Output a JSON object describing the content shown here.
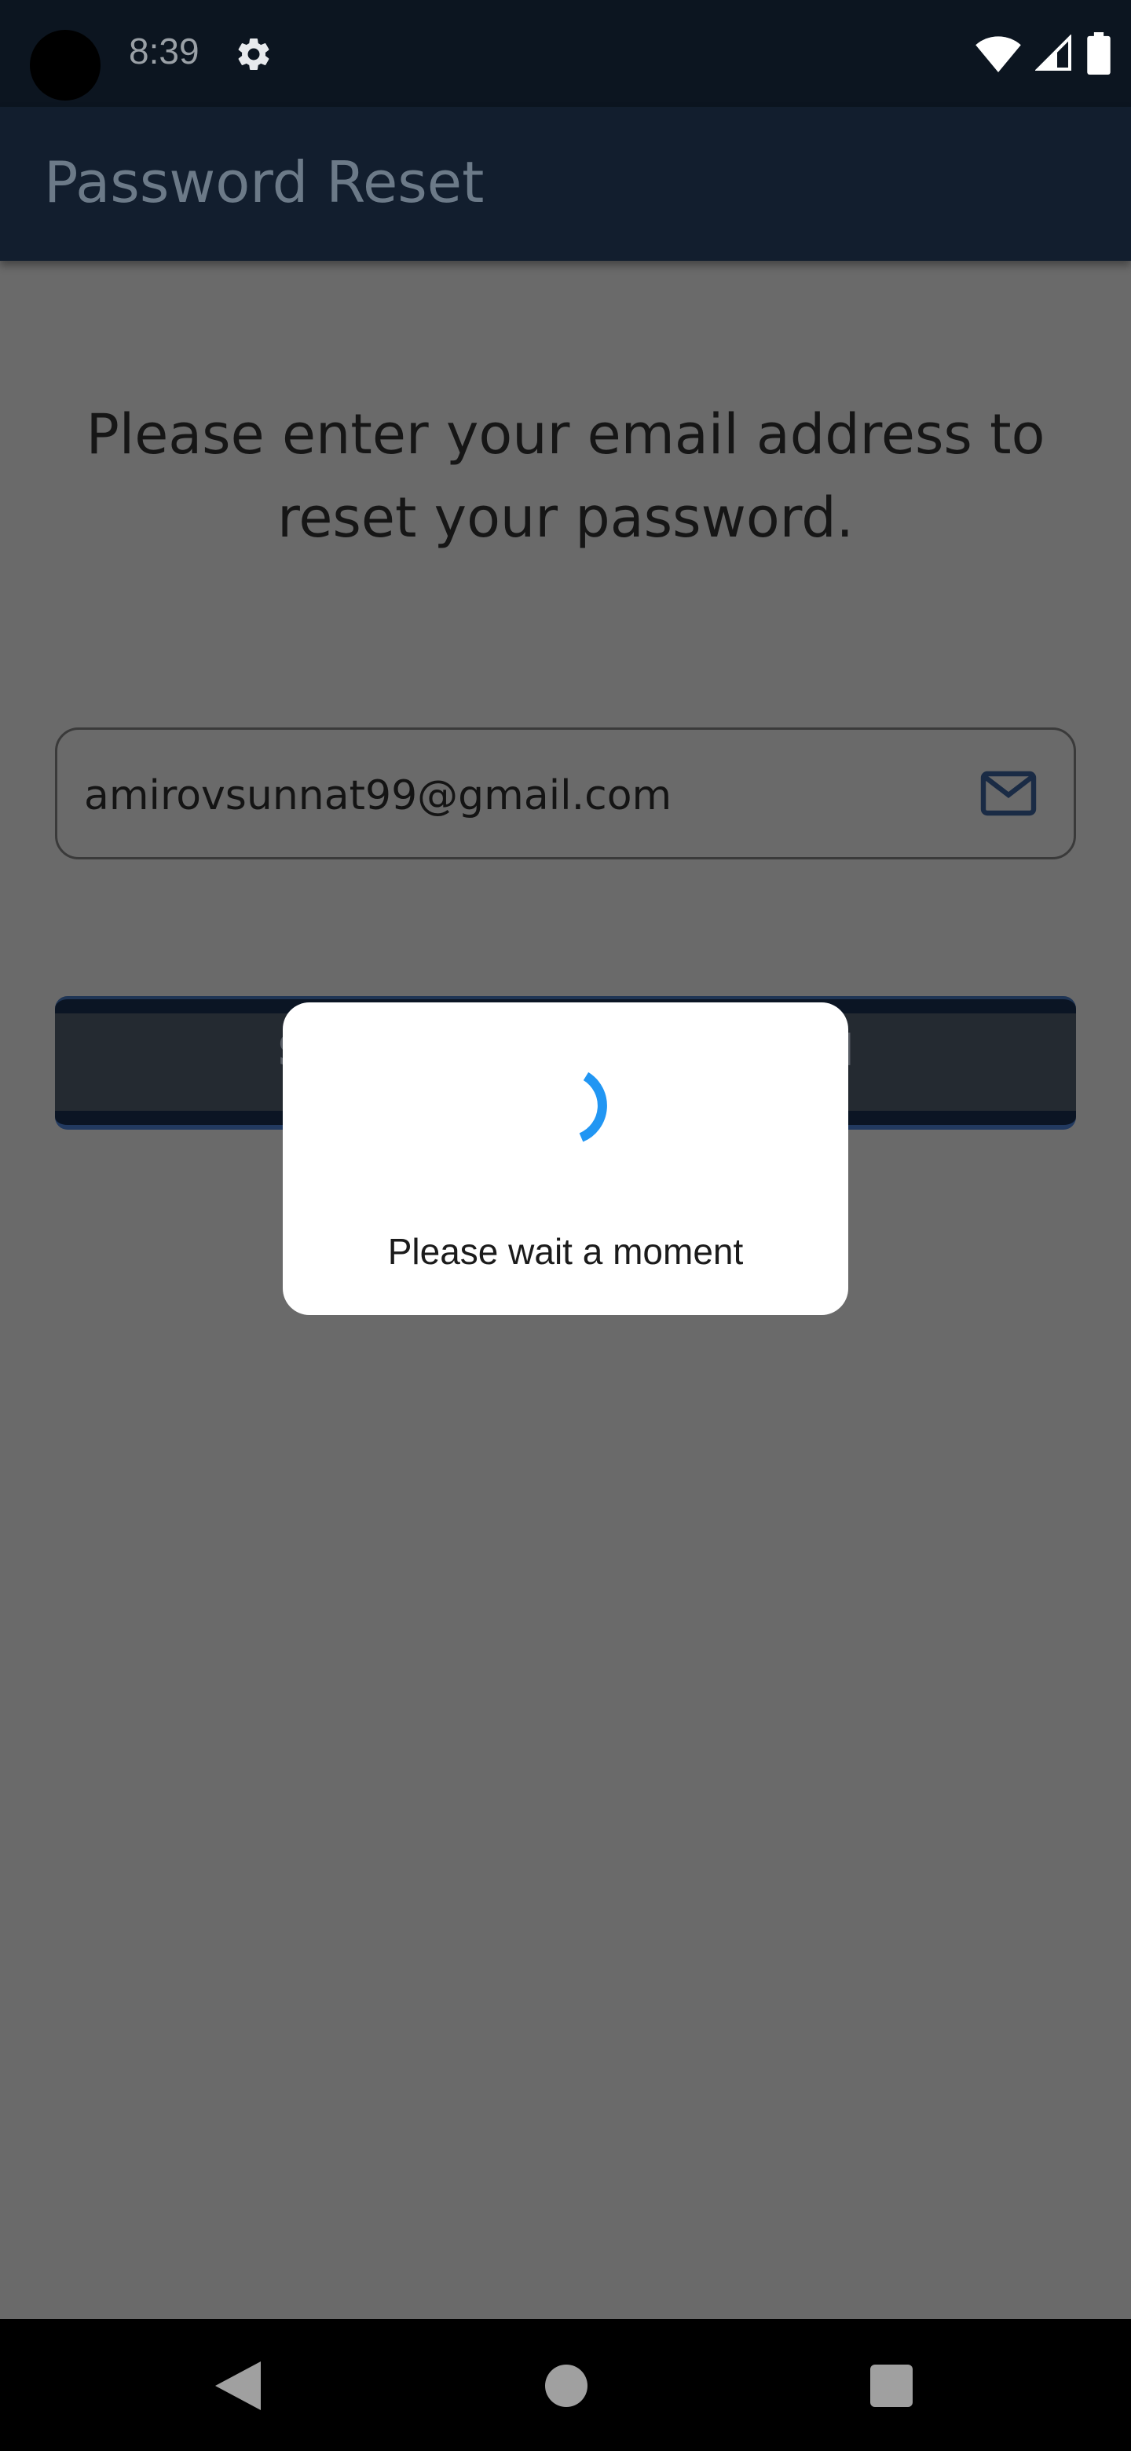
{
  "status_bar": {
    "time": "8:39",
    "icons": [
      "gear-icon",
      "wifi-icon",
      "cellular-signal-icon",
      "battery-icon"
    ]
  },
  "app_bar": {
    "title": "Password Reset"
  },
  "main": {
    "instructions_line1": "Please enter your email address to",
    "instructions_line2": "reset your password.",
    "email_field": {
      "value": "amirovsunnat99@gmail.com",
      "icon": "mail-icon"
    },
    "submit_button": {
      "visible_label": "S                                   il"
    }
  },
  "dialog": {
    "message": "Please wait a moment",
    "spinner_color": "#2196f3"
  },
  "nav_bar": {
    "icons": [
      "back-icon",
      "home-icon",
      "recents-icon"
    ]
  },
  "colors": {
    "status_bar": "#0c1520",
    "app_bar": "#121e2e",
    "scrim": "#6a6a6a"
  }
}
